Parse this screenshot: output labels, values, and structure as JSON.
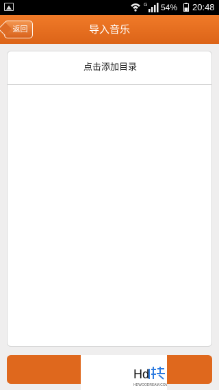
{
  "status_bar": {
    "battery": "54%",
    "time": "20:48",
    "signal_label": "G"
  },
  "title_bar": {
    "back_label": "返回",
    "title": "导入音乐"
  },
  "panel": {
    "header": "点击添加目录",
    "folders": [
      "",
      "",
      "",
      "",
      "",
      "",
      "",
      "",
      "",
      "",
      "",
      ""
    ]
  },
  "colors": {
    "accent": "#e96f22",
    "title_bar": "#df681d",
    "background": "#efeeee"
  }
}
